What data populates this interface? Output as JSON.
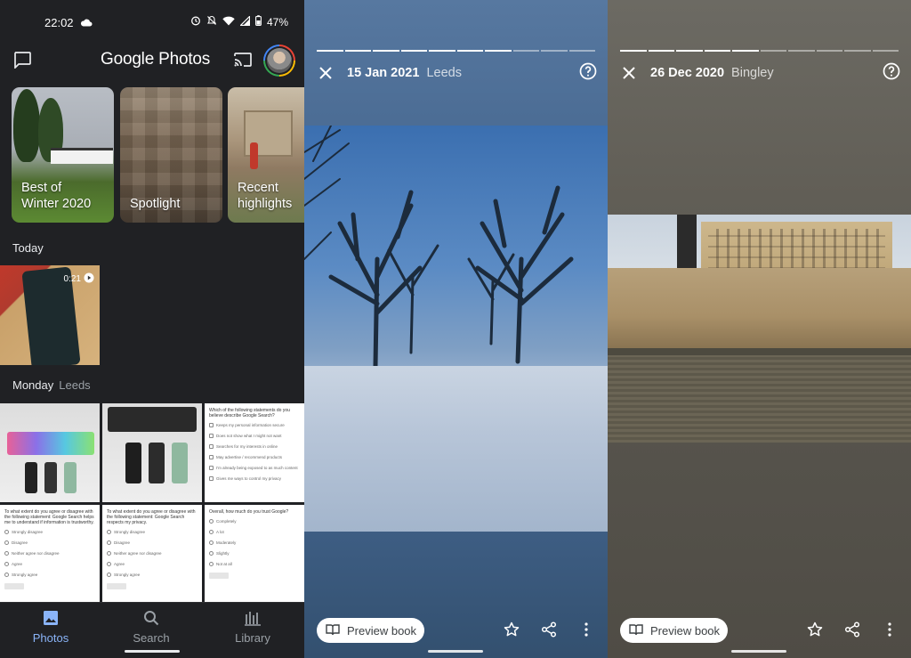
{
  "status_bar": {
    "time": "22:02",
    "battery": "47%"
  },
  "header": {
    "app_title": "Google Photos"
  },
  "memories": [
    {
      "label_line1": "Best of",
      "label_line2": "Winter 2020"
    },
    {
      "label_line1": "",
      "label_line2": "Spotlight"
    },
    {
      "label_line1": "Recent",
      "label_line2": "highlights"
    }
  ],
  "sections": {
    "today": {
      "title": "Today",
      "video_duration": "0:21"
    },
    "monday": {
      "title": "Monday",
      "location": "Leeds"
    }
  },
  "survey_thumbs": [
    {
      "question": "Which of the following statements do you believe describe Google Search?",
      "options": [
        "Keeps my personal information secure",
        "Does not show what I might not want",
        "Searches for my interests in online",
        "May advertise / recommend products",
        "I'm already being exposed to as much content",
        "Gives me ways to control my privacy"
      ]
    },
    {
      "question": "To what extent do you agree or disagree with the following statement: Google Search helps me to understand if information is trustworthy.",
      "options": [
        "Strongly disagree",
        "Disagree",
        "Neither agree nor disagree",
        "Agree",
        "Strongly agree"
      ]
    },
    {
      "question": "To what extent do you agree or disagree with the following statement: Google Search respects my privacy.",
      "options": [
        "Strongly disagree",
        "Disagree",
        "Neither agree nor disagree",
        "Agree",
        "Strongly agree"
      ]
    },
    {
      "question": "Overall, how much do you trust Google?",
      "options": [
        "Completely",
        "A lot",
        "Moderately",
        "Slightly",
        "Not at all"
      ]
    }
  ],
  "bottom_nav": [
    {
      "label": "Photos",
      "active": true
    },
    {
      "label": "Search",
      "active": false
    },
    {
      "label": "Library",
      "active": false
    }
  ],
  "story1": {
    "date": "15 Jan 2021",
    "place": "Leeds",
    "preview_label": "Preview book",
    "progress_done": 7,
    "progress_total": 10
  },
  "story2": {
    "date": "26 Dec 2020",
    "place": "Bingley",
    "preview_label": "Preview book",
    "progress_done": 5,
    "progress_total": 10
  },
  "colors": {
    "accent": "#8ab4f8",
    "background": "#202124"
  }
}
